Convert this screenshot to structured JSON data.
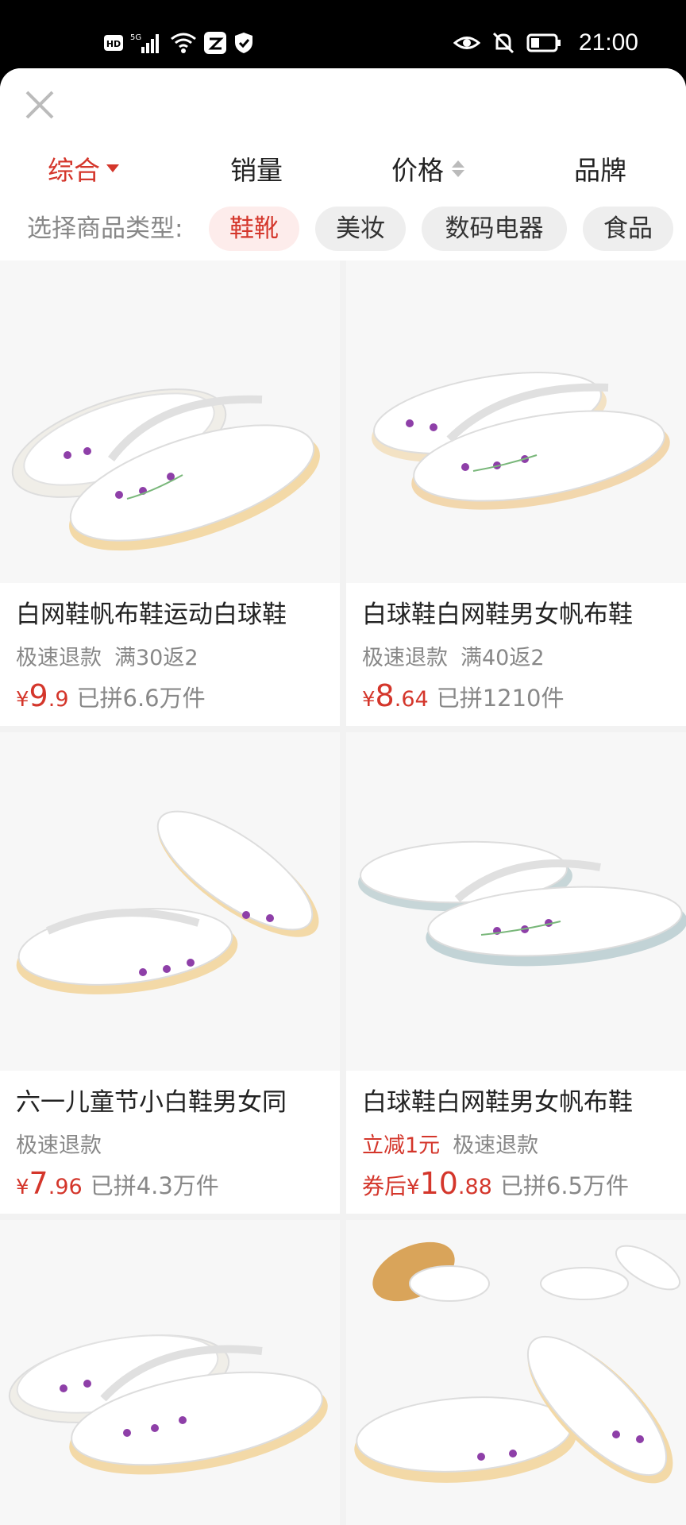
{
  "status_bar": {
    "time": "21:00",
    "left_icons": [
      "hd-icon",
      "5g-signal-icon",
      "wifi-icon",
      "app-icon",
      "shield-icon"
    ],
    "right_icons": [
      "eye-icon",
      "mute-bell-icon",
      "battery-icon"
    ]
  },
  "sort_tabs": [
    {
      "label": "综合",
      "active": true
    },
    {
      "label": "销量",
      "active": false
    },
    {
      "label": "价格",
      "active": false
    },
    {
      "label": "品牌",
      "active": false
    }
  ],
  "type_filter": {
    "label": "选择商品类型:",
    "chips": [
      {
        "label": "鞋靴",
        "active": true
      },
      {
        "label": "美妆",
        "active": false
      },
      {
        "label": "数码电器",
        "active": false
      },
      {
        "label": "食品",
        "active": false
      }
    ]
  },
  "products": [
    {
      "title": "白网鞋帆布鞋运动白球鞋",
      "badge": "",
      "tags": [
        "极速退款",
        "满30返2"
      ],
      "price_prefix": "",
      "currency": "¥",
      "price_int": "9",
      "price_dec": ".9",
      "sold": "已拼6.6万件"
    },
    {
      "title": "白球鞋白网鞋男女帆布鞋",
      "badge": "",
      "tags": [
        "极速退款",
        "满40返2"
      ],
      "price_prefix": "",
      "currency": "¥",
      "price_int": "8",
      "price_dec": ".64",
      "sold": "已拼1210件"
    },
    {
      "title": "六一儿童节小白鞋男女同",
      "badge": "",
      "tags": [
        "极速退款"
      ],
      "price_prefix": "",
      "currency": "¥",
      "price_int": "7",
      "price_dec": ".96",
      "sold": "已拼4.3万件"
    },
    {
      "title": "白球鞋白网鞋男女帆布鞋",
      "badge": "立减1元",
      "tags": [
        "极速退款"
      ],
      "price_prefix": "券后",
      "currency": "¥",
      "price_int": "10",
      "price_dec": ".88",
      "sold": "已拼6.5万件"
    },
    {
      "title": "",
      "badge": "",
      "tags": [],
      "price_prefix": "",
      "currency": "",
      "price_int": "",
      "price_dec": "",
      "sold": ""
    },
    {
      "title": "",
      "badge": "",
      "tags": [],
      "price_prefix": "",
      "currency": "",
      "price_int": "",
      "price_dec": "",
      "sold": ""
    }
  ]
}
